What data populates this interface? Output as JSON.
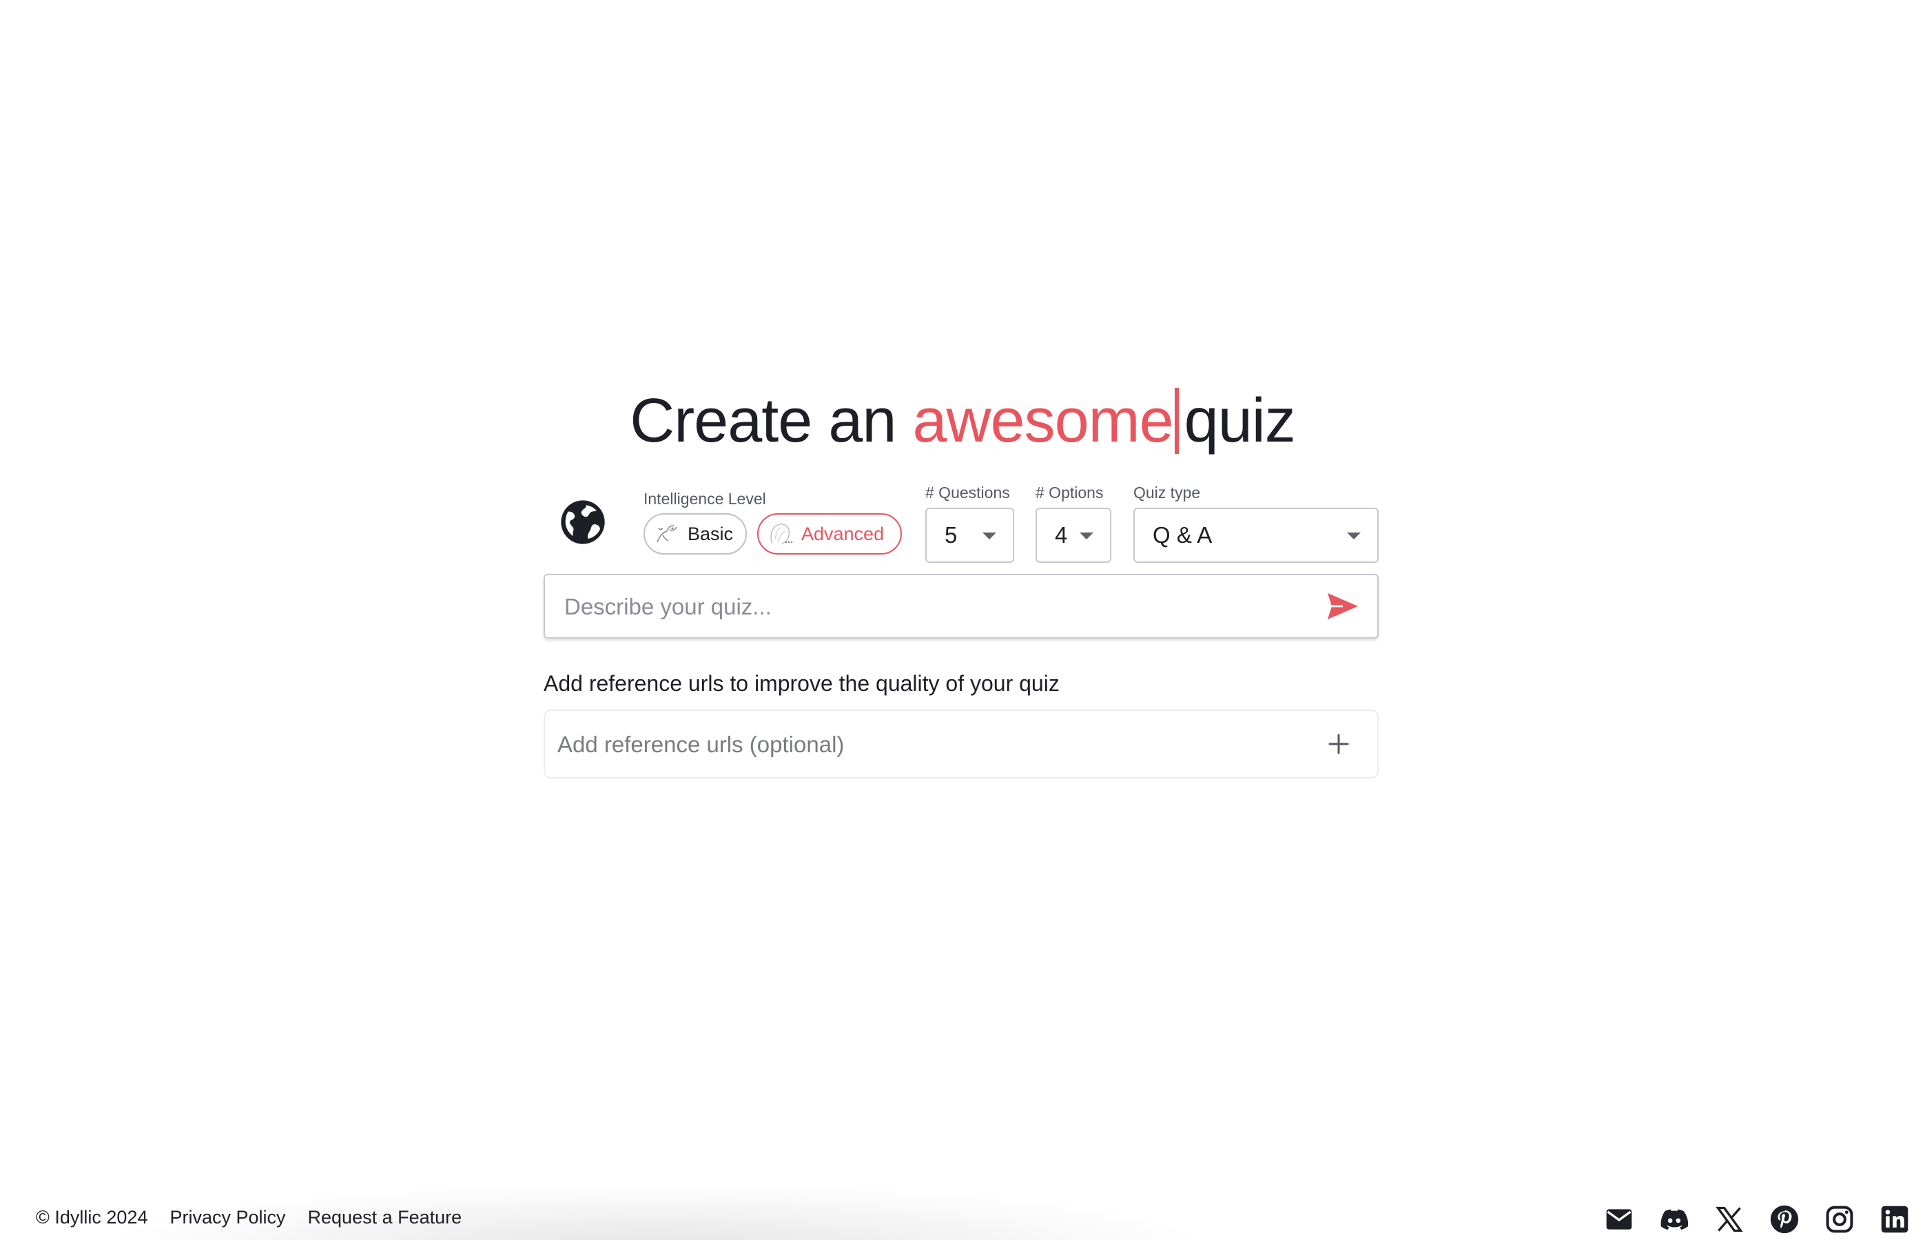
{
  "headline": {
    "prefix": "Create an",
    "accent_word": "awesome",
    "suffix": "quiz"
  },
  "controls": {
    "globe_icon": "globe-icon",
    "intelligence_label": "Intelligence Level",
    "levels": [
      {
        "label": "Basic",
        "icon": "basic-mascot-icon",
        "selected": false
      },
      {
        "label": "Advanced",
        "icon": "advanced-mascot-icon",
        "selected": true
      }
    ],
    "questions_label": "# Questions",
    "questions_value": "5",
    "options_label": "# Options",
    "options_value": "4",
    "quiz_type_label": "Quiz type",
    "quiz_type_value": "Q & A"
  },
  "quiz_input": {
    "placeholder": "Describe your quiz...",
    "value": "",
    "send_icon": "send-icon"
  },
  "references": {
    "heading": "Add reference urls to improve the quality of your quiz",
    "placeholder": "Add reference urls (optional)",
    "add_icon": "plus-icon"
  },
  "footer": {
    "copyright": "© Idyllic 2024",
    "privacy": "Privacy Policy",
    "request": "Request a Feature",
    "social_icons": [
      "mail-icon",
      "discord-icon",
      "x-icon",
      "pinterest-icon",
      "instagram-icon",
      "linkedin-icon"
    ]
  },
  "colors": {
    "accent": "#e8555f",
    "text": "#1e1f26",
    "muted": "#555860",
    "border": "#c7c9ce"
  }
}
